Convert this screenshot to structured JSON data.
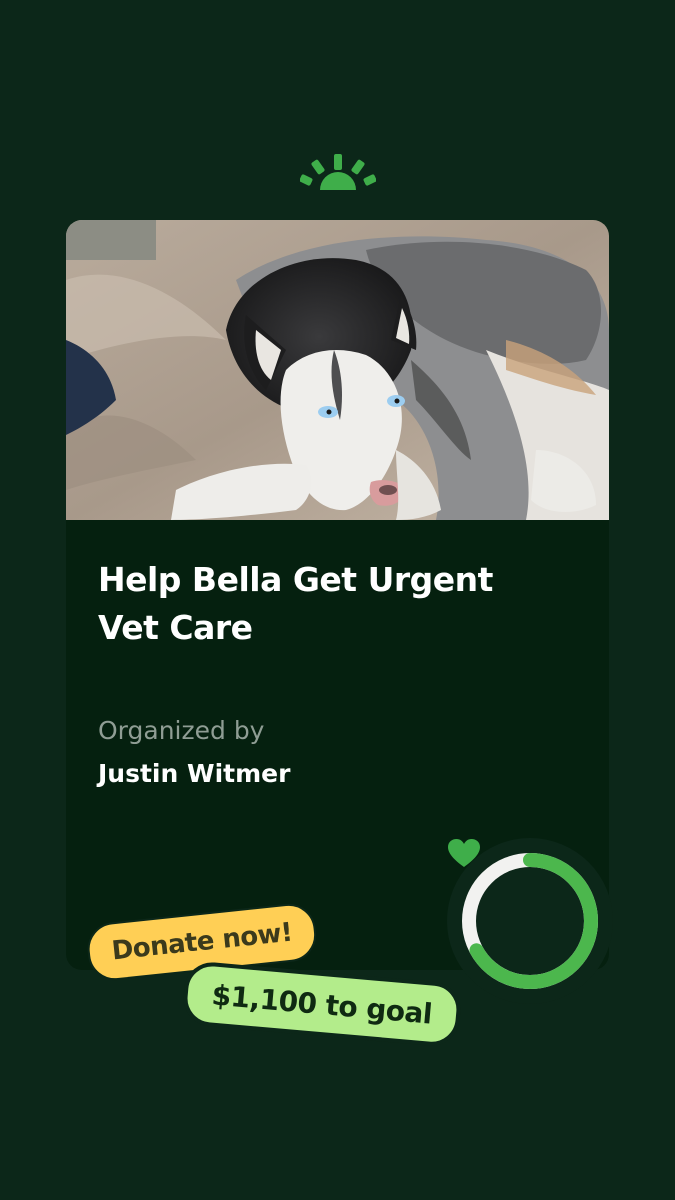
{
  "brand": {
    "logo_icon": "sunrise-logo-icon",
    "logo_color": "#3fae4a"
  },
  "campaign": {
    "photo_alt": "Husky dog lying on a blanket",
    "title": "Help Bella Get Urgent Vet Care",
    "organizer_label": "Organized by",
    "organizer_name": "Justin Witmer"
  },
  "cta": {
    "donate_label": "Donate now!",
    "goal_label": "$1,100 to goal"
  },
  "progress": {
    "fraction": 0.67,
    "icon": "heart-icon",
    "fill_color": "#4cb74d",
    "track_color": "#f2f2f0"
  },
  "colors": {
    "background": "#0c2719",
    "card": "#05200f",
    "donate_pill": "#ffcf55",
    "goal_pill": "#b3ec8b"
  }
}
